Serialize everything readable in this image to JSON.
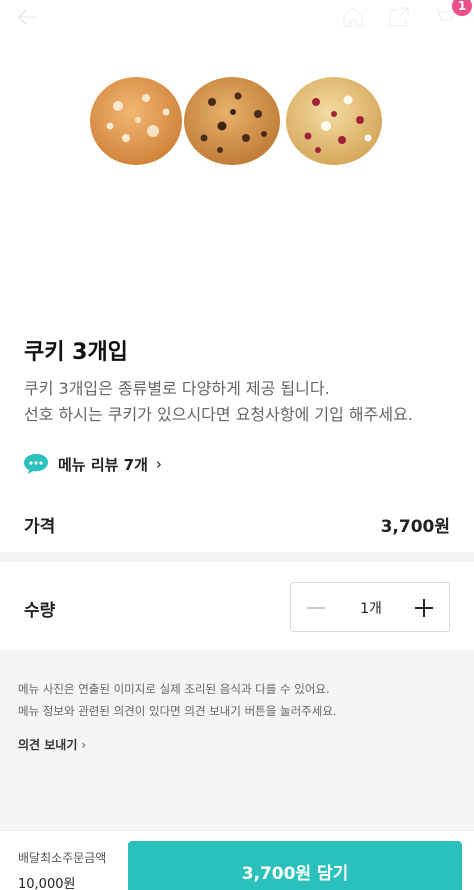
{
  "header": {
    "back_icon": "arrow-left-icon",
    "home_icon": "home-icon",
    "share_icon": "share-icon",
    "cart_icon": "cart-icon",
    "cart_count": "1"
  },
  "product": {
    "name": "쿠키 3개입",
    "description_line1": "쿠키 3개입은 종류별로 다양하게 제공 됩니다.",
    "description_line2": "선호 하시는 쿠키가 있으시다면 요청사항에 기입 해주세요.",
    "review_label": "메뉴 리뷰 7개",
    "review_chevron": "›",
    "image_alt": "cookies"
  },
  "price": {
    "label": "가격",
    "value": "3,700원"
  },
  "quantity": {
    "label": "수량",
    "value": "1개"
  },
  "notice": {
    "line1": "메뉴 사진은 연출된 이미지로 실제 조리된 음식과 다를 수 있어요.",
    "line2": "메뉴 정보와 관련된 의견이 있다면 의견 보내기 버튼을 눌러주세요.",
    "feedback_label": "의견 보내기",
    "feedback_chevron": "›"
  },
  "footer": {
    "min_order_label": "배달최소주문금액",
    "min_order_value": "10,000원",
    "add_button_label": "3,700원 담기"
  },
  "colors": {
    "accent": "#2ac1bc",
    "badge": "#e94f8a"
  }
}
